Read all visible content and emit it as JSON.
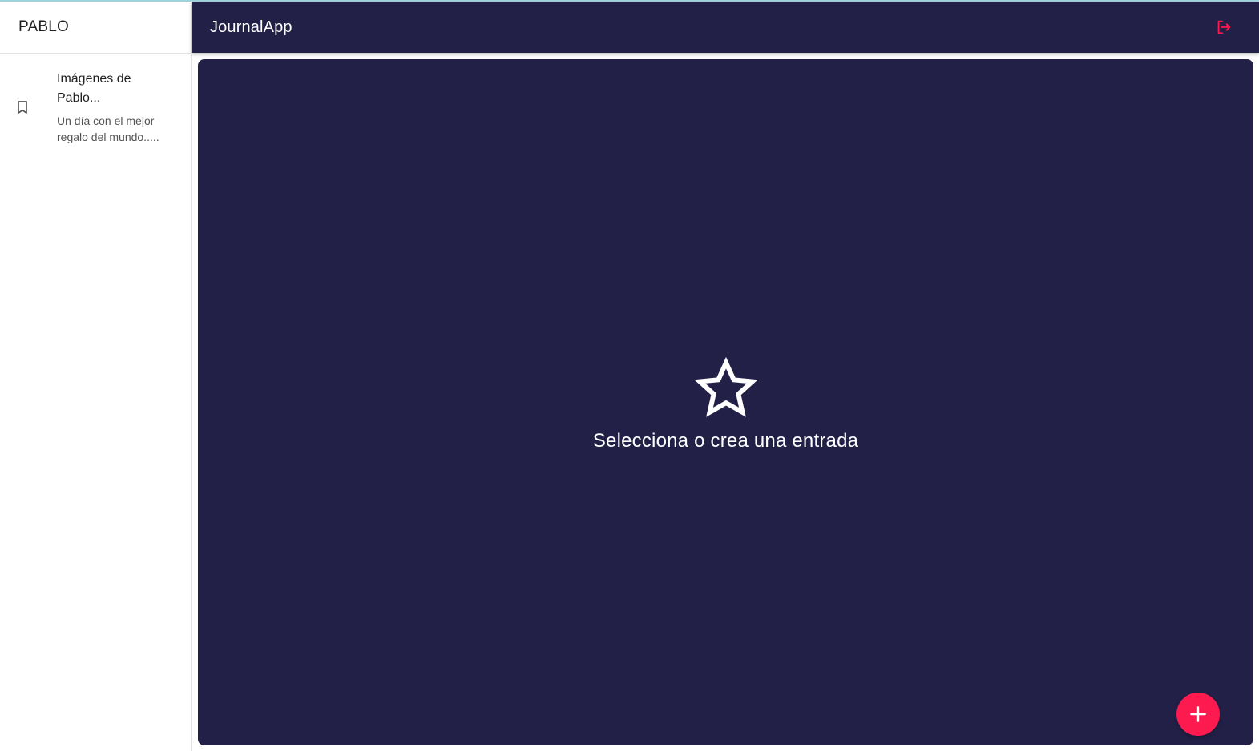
{
  "sidebar": {
    "username": "PABLO",
    "entries": [
      {
        "title": "Imágenes de Pablo...",
        "body": "Un día con el mejor regalo del mundo.....",
        "icon": "bookmark-icon"
      }
    ]
  },
  "appbar": {
    "title": "JournalApp",
    "logout_icon": "logout-icon"
  },
  "main": {
    "empty_message": "Selecciona o crea una entrada",
    "empty_icon": "star-outline-icon",
    "fab_icon": "add-icon"
  },
  "colors": {
    "primary": "#222046",
    "accent": "#fc1a4f",
    "sidebar_bg": "#ffffff"
  }
}
